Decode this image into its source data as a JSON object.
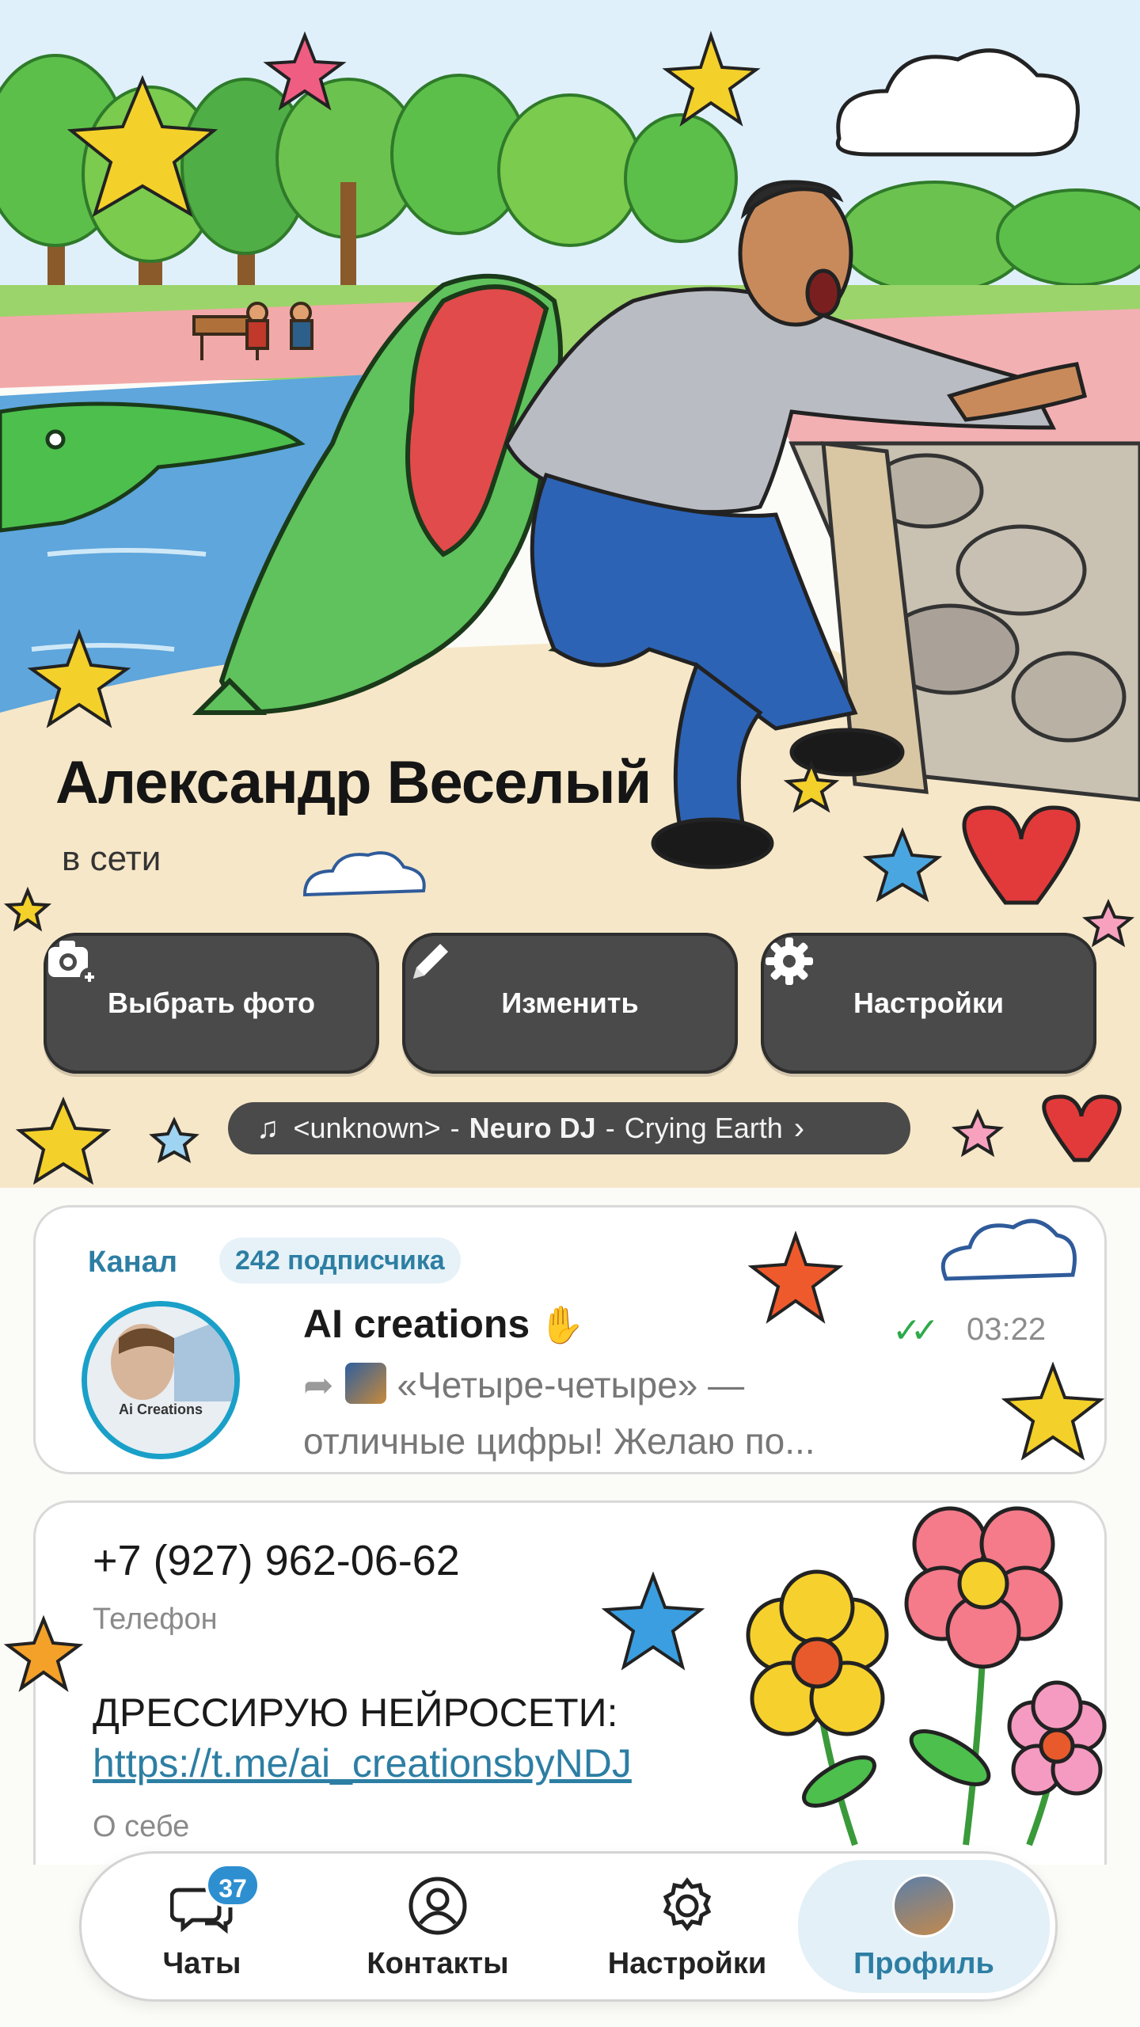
{
  "profile": {
    "name": "Александр Веселый",
    "status": "в сети"
  },
  "actions": {
    "photo_label": "Выбрать фото",
    "edit_label": "Изменить",
    "settings_label": "Настройки"
  },
  "music": {
    "track_prefix": "<unknown>",
    "artist": "Neuro DJ",
    "separator": "-",
    "title": "Crying Earth"
  },
  "channel": {
    "tag": "Канал",
    "subscribers": "242 подписчика",
    "name": "AI creations",
    "avatar_caption": "Ai Creations",
    "time": "03:22",
    "preview_line1": "«Четыре-четыре» —",
    "preview_line2": "отличные цифры! Желаю по..."
  },
  "info": {
    "phone": "+7 (927) 962-06-62",
    "phone_label": "Телефон",
    "bio": "ДРЕССИРУЮ НЕЙРОСЕТИ:",
    "bio_link": "https://t.me/ai_creationsbyNDJ",
    "bio_label": "О себе"
  },
  "nav": {
    "chats_label": "Чаты",
    "chats_badge": "37",
    "contacts_label": "Контакты",
    "settings_label": "Настройки",
    "profile_label": "Профиль",
    "active": "profile"
  },
  "colors": {
    "accent": "#2d7ea3",
    "button_bg": "#4a4a4a",
    "badge": "#2d8fd0",
    "online_check": "#2eaa4a"
  }
}
